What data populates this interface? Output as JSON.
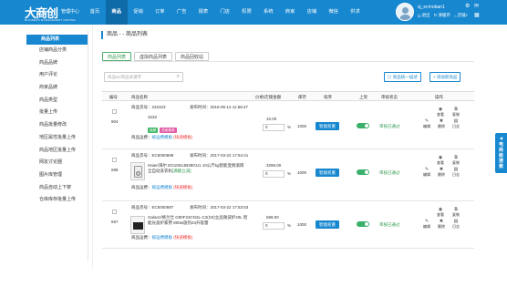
{
  "header": {
    "logo_main": "大商创",
    "logo_manager": "管理中心",
    "logo_sub": "BUSINESS MANAGEMENT CENTER",
    "nav": [
      {
        "label": "首页",
        "active": false
      },
      {
        "label": "商品",
        "active": true
      },
      {
        "label": "促销",
        "active": false
      },
      {
        "label": "订单",
        "active": false
      },
      {
        "label": "广告",
        "active": false
      },
      {
        "label": "报表",
        "active": false
      },
      {
        "label": "门店",
        "active": false
      },
      {
        "label": "权限",
        "active": false
      },
      {
        "label": "系统",
        "active": false
      },
      {
        "label": "商家",
        "active": false
      },
      {
        "label": "店铺",
        "active": false
      },
      {
        "label": "微信",
        "active": false
      },
      {
        "label": "供求",
        "active": false
      }
    ],
    "username": "sj_ecmoban1",
    "links": {
      "exit": "退出",
      "clear_cache": "清缓存",
      "store": "店铺"
    },
    "brand_color": "#1787cf"
  },
  "sidebar": {
    "title": "商品列表",
    "items": [
      "店铺商品分类",
      "商品品牌",
      "用户评论",
      "商家品牌",
      "商品类型",
      "批量上传",
      "商品批量修改",
      "地区属性批量上传",
      "商品地区批量上传",
      "网友讨论圈",
      "图片库管理",
      "商品自动上下架",
      "仓库库存批量上传"
    ]
  },
  "main": {
    "breadcrumb": "商品 - - 商品列表",
    "tabs": [
      {
        "label": "商品列表",
        "active": true
      },
      {
        "label": "虚拟商品列表",
        "active": false
      },
      {
        "label": "商品回收站",
        "active": false
      }
    ],
    "search_placeholder": "商品ID/商品关键字",
    "btn_bulk_export": "商品统一描述",
    "btn_add": "添加新商品",
    "columns": {
      "no": "编号",
      "name": "商品名称",
      "price": "价格/店铺金额",
      "stock": "库存",
      "sort": "排序",
      "onsale": "上架",
      "audit": "审核状态",
      "ops": "操作"
    },
    "rows": [
      {
        "id": "904",
        "sn_label": "商品货号：232323",
        "time_label": "发布时间：2018-06-14 11:58:47",
        "title": "3232",
        "tags": [
          {
            "text": "免邮",
            "color": "#46b96c"
          },
          {
            "text": "热卖推荐",
            "color": "#e05ca6"
          }
        ],
        "freight_prefix": "商品运费：",
        "freight_link": "按运费模板",
        "freight_note": "(快递模板)",
        "price": "10.00",
        "percent": "0",
        "stock": "1000",
        "smart_label": "智能权重",
        "audit": "审核已通过",
        "thumb": "blank"
      },
      {
        "id": "698",
        "sn_label": "商品货号：EC5000698",
        "time_label": "发布时间：2017-03-22 17:54:41",
        "title": "Haier/海尔 EG10014B39GU1 10公斤kg智能变频滚筒全自动洗衣机",
        "title_em": "[满额立减]",
        "tags": [],
        "freight_prefix": "商品运费：",
        "freight_link": "按运费模板",
        "freight_note": "(快递模板)",
        "price": "3299.00",
        "percent": "0",
        "stock": "1000",
        "smart_label": "智能权重",
        "audit": "审核已通过",
        "thumb": "washer"
      },
      {
        "id": "697",
        "sn_label": "商品货号：EC5000697",
        "time_label": "发布时间：2017-03-22 17:53:53",
        "title": "Galanz/格兰仕 G80F23CN3L-C2(S0)立品微波炉20L 智能光波炉家用 800w旋热23升容量",
        "tags": [],
        "freight_prefix": "商品运费：",
        "freight_link": "按运费模板",
        "freight_note": "(快递模板)",
        "price": "599.00",
        "percent": "0",
        "stock": "1000",
        "smart_label": "智能权重",
        "audit": "审核已通过",
        "thumb": "tv"
      }
    ],
    "op_labels": {
      "view": "查看",
      "copy": "复制",
      "edit": "编辑",
      "delete": "删除",
      "log": "日志"
    }
  },
  "float_tab": "电商级搜索"
}
